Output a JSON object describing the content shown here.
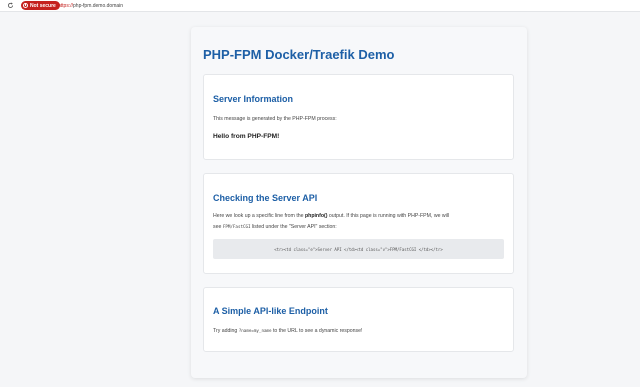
{
  "browser": {
    "security_label": "Not secure",
    "url": {
      "protocol": "https://",
      "host": "php-fpm.demo.domain"
    }
  },
  "page": {
    "title": "PHP-FPM Docker/Traefik Demo"
  },
  "server_info": {
    "title": "Server Information",
    "text": "This message is generated by the PHP-FPM process:",
    "message": "Hello from PHP-FPM!"
  },
  "server_api": {
    "title": "Checking the Server API",
    "line1_a": "Here we look up a specific line from the ",
    "line1_b": "phpinfo()",
    "line1_c": " output. If this page is running with PHP-FPM, we will",
    "line2_a": "see ",
    "line2_b": "FPM/FastCGI",
    "line2_c": " listed under the \"Server API\" section:",
    "code": "<tr><td class=\"e\">Server API </td><td class=\"v\">FPM/FastCGI </td></tr>"
  },
  "endpoint": {
    "title": "A Simple API-like Endpoint",
    "text_a": "Try adding ",
    "text_b": "?name=my_name",
    "text_c": " to the URL to see a dynamic response!"
  },
  "colors": {
    "accent": "#1d5fa6",
    "not_secure": "#c5221f"
  }
}
